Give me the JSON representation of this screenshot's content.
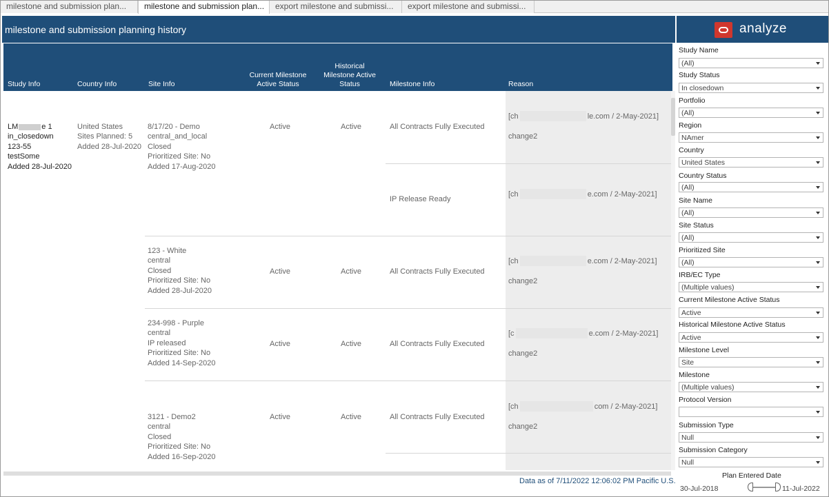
{
  "tabs": [
    {
      "label": "milestone and submission plan..."
    },
    {
      "label": "milestone and submission plan..."
    },
    {
      "label": "export milestone and submissi..."
    },
    {
      "label": "export milestone and submissi..."
    }
  ],
  "title": "milestone and submission planning history",
  "logo_text": "analyze",
  "columns": {
    "study": "Study Info",
    "country": "Country Info",
    "site": "Site Info",
    "current": "Current Milestone\nActive Status",
    "historical": "Historical\nMilestone Active\nStatus",
    "milestone": "Milestone Info",
    "reason": "Reason"
  },
  "study": {
    "line1": "LM",
    "line1_end": "e 1",
    "line2": "in_closedown",
    "line3": "123-55",
    "line4": "testSome",
    "line5": "Added 28-Jul-2020"
  },
  "country": {
    "text": "United States\nSites Planned: 5\nAdded 28-Jul-2020"
  },
  "rows": [
    {
      "site": "8/17/20 - Demo\ncentral_and_local\nClosed\nPrioritized Site: No\nAdded 17-Aug-2020",
      "current": "Active",
      "historical": "Active",
      "entries": [
        {
          "milestone": "All Contracts Fully Executed",
          "reason_prefix": "[ch",
          "reason_suffix": "le.com / 2-May-2021]",
          "reason_note": "change2"
        },
        {
          "milestone": "IP Release Ready",
          "reason_prefix": "[ch",
          "reason_suffix": "e.com / 2-May-2021]",
          "reason_note": ""
        }
      ]
    },
    {
      "site": "123 - White\ncentral\nClosed\nPrioritized Site: No\nAdded 28-Jul-2020",
      "current": "Active",
      "historical": "Active",
      "entries": [
        {
          "milestone": "All Contracts Fully Executed",
          "reason_prefix": "[ch",
          "reason_suffix": "e.com / 2-May-2021]",
          "reason_note": "change2"
        }
      ]
    },
    {
      "site": "234-998 - Purple\ncentral\nIP released\nPrioritized Site: No\nAdded 14-Sep-2020",
      "current": "Active",
      "historical": "Active",
      "entries": [
        {
          "milestone": "All Contracts Fully Executed",
          "reason_prefix": "[c",
          "reason_suffix": "e.com / 2-May-2021]",
          "reason_note": "change2"
        }
      ]
    },
    {
      "site": "3121 - Demo2\ncentral\nClosed\nPrioritized Site: No\nAdded 16-Sep-2020",
      "current": "Active",
      "historical": "Active",
      "entries": [
        {
          "milestone": "All Contracts Fully Executed",
          "reason_prefix": "[ch",
          "reason_suffix": "com / 2-May-2021]",
          "reason_note": "change2"
        }
      ]
    }
  ],
  "footer_note": "Data as of 7/11/2022 12:06:02 PM Pacific U.S.",
  "filters": [
    {
      "label": "Study Name",
      "value": "(All)"
    },
    {
      "label": "Study Status",
      "value": "In closedown"
    },
    {
      "label": "Portfolio",
      "value": "(All)"
    },
    {
      "label": "Region",
      "value": "NAmer"
    },
    {
      "label": "Country",
      "value": "United States"
    },
    {
      "label": "Country Status",
      "value": "(All)"
    },
    {
      "label": "Site Name",
      "value": "(All)"
    },
    {
      "label": "Site Status",
      "value": "(All)"
    },
    {
      "label": "Prioritized Site",
      "value": "(All)"
    },
    {
      "label": "IRB/EC Type",
      "value": "(Multiple values)"
    },
    {
      "label": "Current Milestone Active Status",
      "value": "Active"
    },
    {
      "label": "Historical Milestone Active Status",
      "value": "Active"
    },
    {
      "label": "Milestone Level",
      "value": "Site"
    },
    {
      "label": "Milestone",
      "value": "(Multiple values)"
    },
    {
      "label": "Protocol Version",
      "value": ""
    },
    {
      "label": "Submission Type",
      "value": "Null"
    },
    {
      "label": "Submission Category",
      "value": "Null"
    }
  ],
  "date_filter": {
    "label": "Plan Entered Date",
    "start": "30-Jul-2018",
    "end": "11-Jul-2022"
  },
  "colors": {
    "header_blue": "#1f4e79",
    "logo_red": "#d0372e"
  }
}
